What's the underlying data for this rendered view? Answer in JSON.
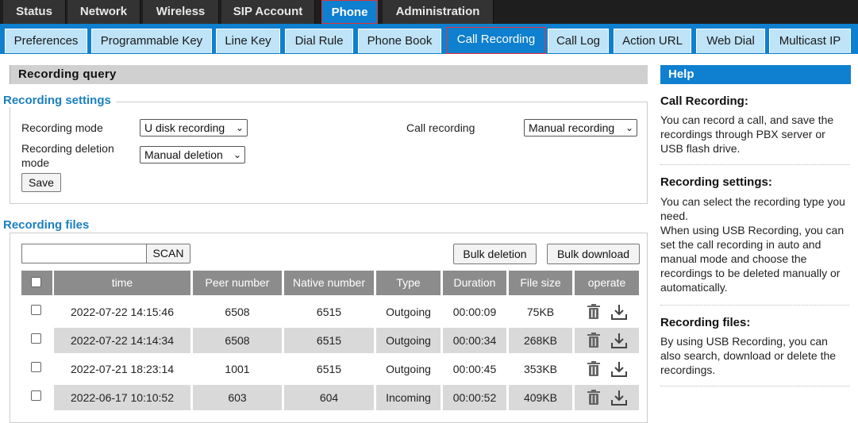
{
  "top_nav": [
    "Status",
    "Network",
    "Wireless",
    "SIP Account",
    "Phone",
    "Administration"
  ],
  "sub_nav": [
    "Preferences",
    "Programmable Key",
    "Line Key",
    "Dial Rule",
    "Phone Book",
    "Call Recording",
    "Call Log",
    "Action URL",
    "Web Dial",
    "Multicast IP"
  ],
  "page": {
    "section_title": "Recording query",
    "settings": {
      "legend": "Recording settings",
      "mode_label": "Recording mode",
      "mode_value": "U disk recording",
      "call_recording_label": "Call recording",
      "call_recording_value": "Manual recording",
      "deletion_label_line1": "Recording deletion",
      "deletion_label_line2": "mode",
      "deletion_value": "Manual deletion",
      "save_label": "Save"
    },
    "files": {
      "legend": "Recording files",
      "search_value": "",
      "scan_label": "SCAN",
      "bulk_delete_label": "Bulk deletion",
      "bulk_download_label": "Bulk download",
      "columns": [
        "time",
        "Peer number",
        "Native number",
        "Type",
        "Duration",
        "File size",
        "operate"
      ],
      "rows": [
        [
          "2022-07-22 14:15:46",
          "6508",
          "6515",
          "Outgoing",
          "00:00:09",
          "75KB"
        ],
        [
          "2022-07-22 14:14:34",
          "6508",
          "6515",
          "Outgoing",
          "00:00:34",
          "268KB"
        ],
        [
          "2022-07-21 18:23:14",
          "1001",
          "6515",
          "Outgoing",
          "00:00:45",
          "353KB"
        ],
        [
          "2022-06-17 10:10:52",
          "603",
          "604",
          "Incoming",
          "00:00:52",
          "409KB"
        ]
      ]
    }
  },
  "help": {
    "title": "Help",
    "s1_title": "Call Recording:",
    "s1_text": "You can record a call, and save the recordings through PBX server or USB flash drive.",
    "s2_title": "Recording settings:",
    "s2_text1": "You can select the recording type you need.",
    "s2_text2": "When using USB Recording, you can set the call recording in auto and manual mode and choose the recordings to be deleted manually or automatically.",
    "s3_title": "Recording files:",
    "s3_text": "By using USB Recording, you can also search, download or delete the recordings."
  },
  "icons": {
    "delete": "trash-icon",
    "download": "download-icon",
    "dropdown": "chevron-down-icon"
  },
  "colors": {
    "accent": "#0f7fcf",
    "legend": "#1a7fc0",
    "active_outline": "#dd3333"
  }
}
